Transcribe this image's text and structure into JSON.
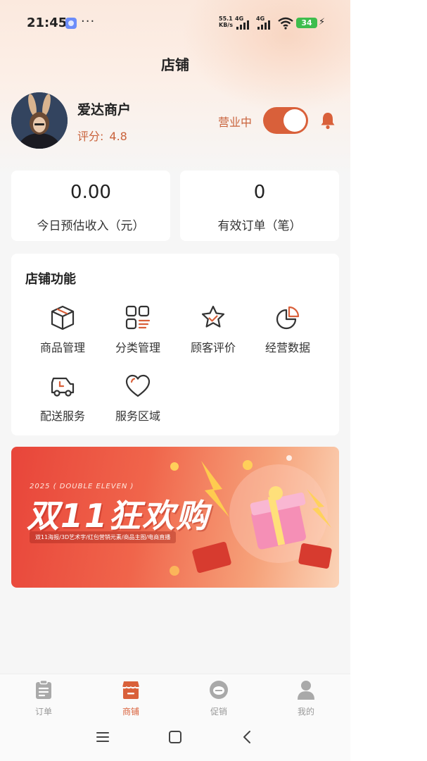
{
  "status_bar": {
    "time": "21:45",
    "more": "···",
    "net_speed_value": "55.1",
    "net_speed_unit": "KB/s",
    "sim1_tag": "4G",
    "sim2_tag": "4G",
    "battery": "34"
  },
  "header": {
    "title": "店铺"
  },
  "profile": {
    "name": "爱达商户",
    "rating_label": "评分:",
    "rating_value": "4.8",
    "business_status": "营业中",
    "business_open": true
  },
  "stats": [
    {
      "value": "0.00",
      "label": "今日预估收入（元）"
    },
    {
      "value": "0",
      "label": "有效订单（笔）"
    }
  ],
  "functions": {
    "title": "店铺功能",
    "items": [
      {
        "label": "商品管理",
        "icon": "box-icon"
      },
      {
        "label": "分类管理",
        "icon": "category-icon"
      },
      {
        "label": "顾客评价",
        "icon": "star-review-icon"
      },
      {
        "label": "经营数据",
        "icon": "pie-chart-icon"
      },
      {
        "label": "配送服务",
        "icon": "delivery-truck-icon"
      },
      {
        "label": "服务区域",
        "icon": "heart-icon"
      }
    ]
  },
  "banner": {
    "subtitle": "2025 ( DOUBLE ELEVEN )",
    "headline": "双11狂欢购",
    "tags": "双11海报/3D艺术字/红包营销元素/商品主图/电商直播"
  },
  "bottom_nav": [
    {
      "label": "订单",
      "icon": "clipboard-icon",
      "active": false
    },
    {
      "label": "商铺",
      "icon": "shop-icon",
      "active": true
    },
    {
      "label": "促销",
      "icon": "promotion-icon",
      "active": false
    },
    {
      "label": "我的",
      "icon": "user-icon",
      "active": false
    }
  ],
  "colors": {
    "accent": "#d9603a",
    "rating": "#c9623b",
    "banner": "#e8453a"
  }
}
